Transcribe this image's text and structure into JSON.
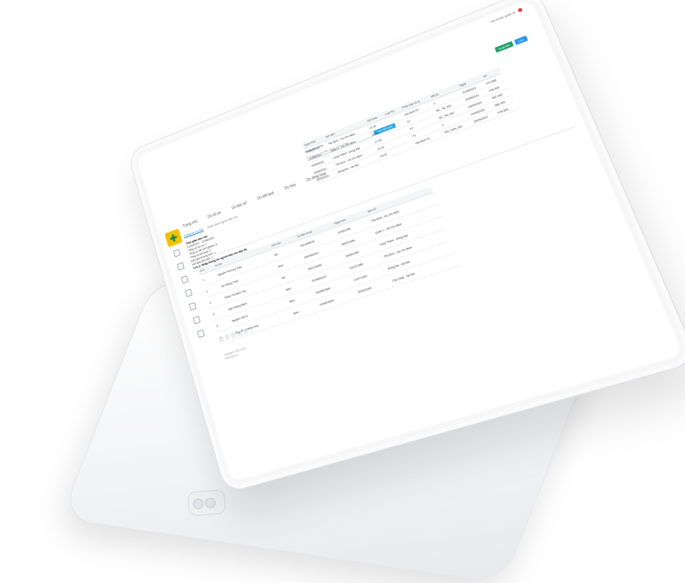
{
  "app": {
    "topbar_tabs": [
      "Trang chủ",
      "Ds hồ sơ",
      "Ds bàn số",
      "Ds kết quả",
      "Ds hóa",
      "Ds tổng hợp"
    ],
    "user_menu": "Tài khoản quản trị",
    "notification_count": ""
  },
  "search": {
    "label": "Nhập tìm kiếm",
    "placeholder": "Nhập tên, số điện thoại, số hộ chiếu",
    "button": "Lưu kết quả"
  },
  "actions": {
    "export": "Xuất file",
    "save": "Lưu"
  },
  "panel_tabs": [
    "Thông tin cơ bản",
    "Danh sách người tiếp xúc"
  ],
  "info": {
    "date_label": "Thời gian báo cáo",
    "date_value": "01/06/2021 - 21/06/2021",
    "lines": [
      "Tổng số hồ sơ: 7",
      "Tổng số đã xét nghiệm: 6",
      "Tổng số kết quả: 2",
      "Kết quả dương tính: 1",
      "Kết quả âm tính: 1"
    ],
    "note": "Lưu ý: Nhập thông tin người tiếp xúc đầy đủ"
  },
  "grid": {
    "headers": [
      "Ngày khai",
      "Nơi đến",
      "Giờ khai",
      "Loại TG",
      "Phân loại xử lý",
      "Mã số",
      "Ngày",
      "Số"
    ],
    "rows": [
      [
        "21/05/2021",
        "Tân Bình - Hồ Chí Minh",
        "11:20",
        "",
        "Gia đình F0",
        "1",
        "21/05/2021",
        "070.955"
      ],
      [
        "21/05/2021",
        "Quận 1 - Hồ Chí Minh",
        "10:30",
        "",
        "F1",
        "BC_TB_001",
        "22/05/2021",
        "076.900"
      ],
      [
        "22/05/2021",
        "Long Thành - Đồng Nai",
        "17:45",
        "",
        "F2",
        "BC_TB_002",
        "23/05/2021",
        "052.300"
      ],
      [
        "23/05/2021",
        "Thủ Đức - Hồ Chí Minh",
        "14:15",
        "",
        "F1",
        "3",
        "24/05/2021",
        "080.400"
      ],
      [
        "24/05/2021",
        "Đống Đa - Hà Nội",
        "19:00",
        "",
        "Gia đình F0",
        "PM_GVN_001",
        "25/05/2021",
        "075.500"
      ]
    ]
  },
  "table": {
    "headers": [
      "STT",
      "Họ tên",
      "Giới tính",
      "Số điện thoại",
      "Ngày sinh",
      "Địa chỉ"
    ],
    "rows": [
      [
        "1",
        "Nguyễn Phương Thảo",
        "Nữ",
        "0912345678",
        "12/05/1990",
        "Tân Bình - Hồ Chí Minh"
      ],
      [
        "2",
        "Hồ Hoàng Tuấn",
        "Nam",
        "0987654321",
        "08/02/1986",
        "Quận 1 - Hồ Chí Minh"
      ],
      [
        "3",
        "Phạm Thị Minh Thư",
        "Nữ",
        "0901234567",
        "25/09/1995",
        "Long Thành - Đồng Nai"
      ],
      [
        "4",
        "Ngô Hoàng Bách",
        "Nam",
        "0976543210",
        "03/11/1988",
        "Thủ Đức - Hồ Chí Minh"
      ],
      [
        "5",
        "Nguyễn Văn A",
        "Nam",
        "0934567890",
        "17/07/1992",
        "Đống Đa - Hà Nội"
      ],
      [
        "6",
        "Nguyễn Hoàng Long",
        "Nam",
        "0945678901",
        "30/04/1999",
        "Cầu Giấy - Hà Nội"
      ]
    ]
  },
  "pager": [
    "1",
    "2",
    "3",
    "4",
    "5"
  ],
  "footer": [
    "Copyright © 2021 CDC",
    "Phiên bản 1.0"
  ],
  "colors": {
    "brand_yellow": "#f2c200",
    "brand_green": "#1b8a4b",
    "accent_blue": "#2196f3",
    "accent_green": "#22a06b"
  }
}
